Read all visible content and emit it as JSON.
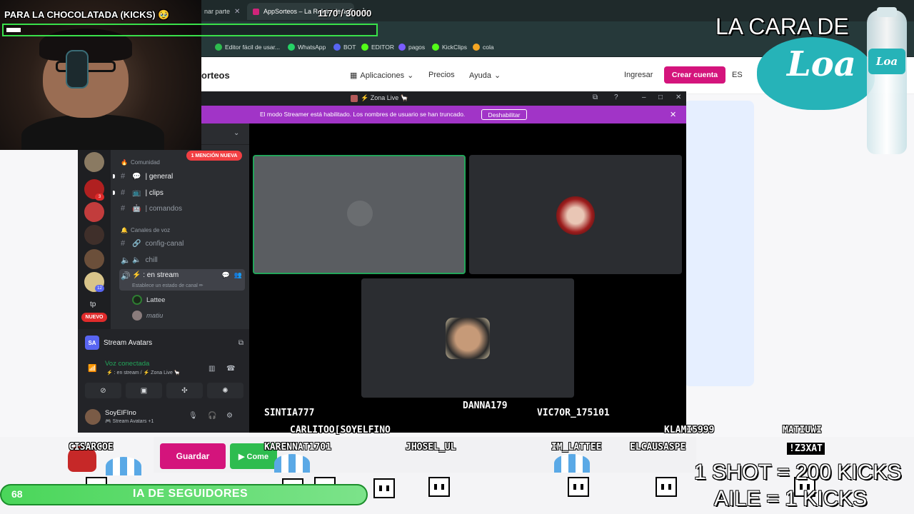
{
  "browser": {
    "tabs": [
      {
        "label": "nar parte",
        "active": false
      },
      {
        "label": "AppSorteos – La Ruleta de la S",
        "active": true
      }
    ],
    "bookmarks": [
      {
        "label": "Editor fácil de usar...",
        "color": "#2ebc4f"
      },
      {
        "label": "WhatsApp",
        "color": "#25d366"
      },
      {
        "label": "BOT",
        "color": "#5865f2"
      },
      {
        "label": "EDITOR",
        "color": "#53fc18"
      },
      {
        "label": "pagos",
        "color": "#7a5cff"
      },
      {
        "label": "KickClips",
        "color": "#53fc18"
      },
      {
        "label": "cola",
        "color": "#f5a623"
      }
    ]
  },
  "site": {
    "logo": "orteos",
    "nav": {
      "aplicaciones": "Aplicaciones",
      "precios": "Precios",
      "ayuda": "Ayuda",
      "ingresar": "Ingresar",
      "crear_cuenta": "Crear cuenta",
      "language": "ES"
    },
    "guardar": "Guardar",
    "comenzar": "▶ Come",
    "accent": "#d4147c"
  },
  "discord": {
    "window_title": "⚡ Zona Live 🦙",
    "banner": {
      "text": "El modo Streamer está habilitado. Los nombres de usuario se han truncado.",
      "button": "Deshabilitar"
    },
    "mention_pill": "1 MENCIÓN NUEVA",
    "servers": [
      {
        "badge": ""
      },
      {
        "badge": "3"
      },
      {
        "badge": ""
      },
      {
        "badge": ""
      },
      {
        "badge": ""
      },
      {
        "badge": "12"
      }
    ],
    "server_text": "tp",
    "nuevo": "NUEVO",
    "category_1": "Comunidad",
    "channels_text": [
      {
        "icon": "💬",
        "name": "| general",
        "bright": true
      },
      {
        "icon": "📺",
        "name": "| clips",
        "bright": true
      },
      {
        "icon": "🤖",
        "name": "| comandos",
        "bright": false
      }
    ],
    "category_2": "Canales de voz",
    "channels_voice": [
      {
        "icon": "🔗",
        "name": "config-canal",
        "kind": "text"
      },
      {
        "icon": "🔈",
        "name": "chill",
        "kind": "voice"
      }
    ],
    "active_channel": {
      "name": "⚡ : en stream",
      "sub": "Establece un estado de canal ✏"
    },
    "members": [
      {
        "name": "Lattee",
        "color": "#2e7d32"
      },
      {
        "name": "matiu",
        "color": "#8a7c7c"
      }
    ],
    "app_name": "Stream Avatars",
    "voice": {
      "status": "Voz conectada",
      "sub": "⚡ : en stream / ⚡ Zona Live 🦙"
    },
    "user": {
      "name": "SoyElFIno",
      "sub": "🎮 Stream Avatars +1"
    },
    "tiles": [
      "speaking",
      "avatar-red",
      "avatar-glasses"
    ]
  },
  "overlay": {
    "goal_title": "PARA LA CHOCOLATADA (KICKS) 🥹",
    "goal_count": "1170  / 30000",
    "goal_progress": 0.039,
    "brand": "LA CARA DE",
    "loa": "Loa",
    "nicks": [
      {
        "text": "SINTIA777",
        "style": "plain"
      },
      {
        "text": "DANNA179",
        "style": "plain"
      },
      {
        "text": "VIC7OR_175101",
        "style": "plain"
      },
      {
        "text": "CARLITOO[SOYELFINO",
        "style": "plain"
      },
      {
        "text": "KLAMI5999",
        "style": "plain"
      },
      {
        "text": "MATIUWI",
        "style": "plain"
      },
      {
        "text": "CISARCOE",
        "style": "plain"
      },
      {
        "text": "KARENNAT1701",
        "style": "plain"
      },
      {
        "text": "JHOSEL_UL",
        "style": "plain"
      },
      {
        "text": "IM_LATTEE",
        "style": "plain"
      },
      {
        "text": "ELCAUSASPE",
        "style": "plain"
      },
      {
        "text": "!Z3XAT",
        "style": "badge"
      }
    ],
    "followers_count": "68",
    "followers_text": "IA DE SEGUIDORES",
    "promo_line_1": "1 SHOT = 200 KICKS",
    "promo_line_2": "AILE = 1  KICKS"
  }
}
